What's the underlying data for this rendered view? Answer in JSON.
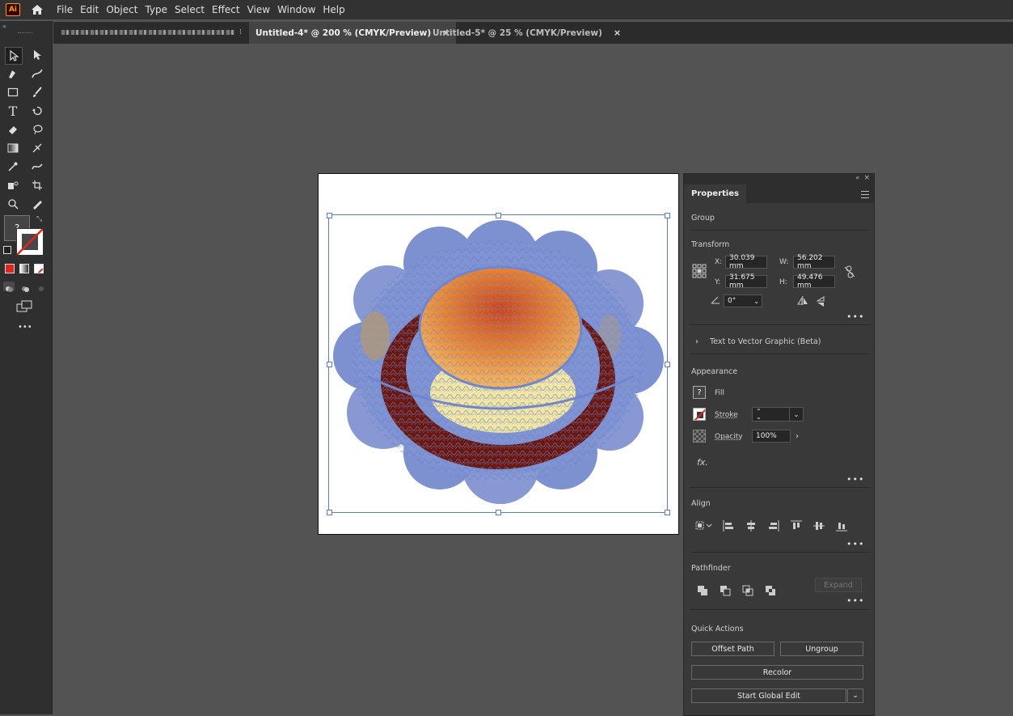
{
  "menubar": {
    "logo": "Ai",
    "items": [
      "File",
      "Edit",
      "Object",
      "Type",
      "Select",
      "Effect",
      "View",
      "Window",
      "Help"
    ]
  },
  "tabs": [
    {
      "label": "Untitled-4* @ 200 % (CMYK/Preview)",
      "close": "×",
      "active": true
    },
    {
      "label": "Untitled-5* @ 25 % (CMYK/Preview)",
      "close": "×",
      "active": false
    }
  ],
  "toolbar": {
    "fill_indicator": "?",
    "more": "•••"
  },
  "properties": {
    "tab_label": "Properties",
    "selection_type": "Group",
    "transform": {
      "title": "Transform",
      "x_label": "X:",
      "x_value": "30.039 mm",
      "y_label": "Y:",
      "y_value": "31.675 mm",
      "w_label": "W:",
      "w_value": "56.202 mm",
      "h_label": "H:",
      "h_value": "49.476 mm",
      "angle_value": "0°"
    },
    "text_to_vector": "Text to Vector Graphic (Beta)",
    "appearance": {
      "title": "Appearance",
      "fill_label": "Fill",
      "fill_swatch": "?",
      "stroke_label": "Stroke",
      "opacity_label": "Opacity",
      "opacity_value": "100%",
      "fx_label": "fx."
    },
    "align": {
      "title": "Align"
    },
    "pathfinder": {
      "title": "Pathfinder",
      "expand_label": "Expand"
    },
    "quick_actions": {
      "title": "Quick Actions",
      "offset_path": "Offset Path",
      "ungroup": "Ungroup",
      "recolor": "Recolor",
      "start_global_edit": "Start Global Edit"
    },
    "more_dots": "•••"
  },
  "colors": {
    "accent_selection": "#5a7cd8",
    "stroke_red": "#e0251d",
    "art_blue": "#6f86cf",
    "art_orange": "#e07a2e",
    "art_maroon": "#6a1812"
  }
}
